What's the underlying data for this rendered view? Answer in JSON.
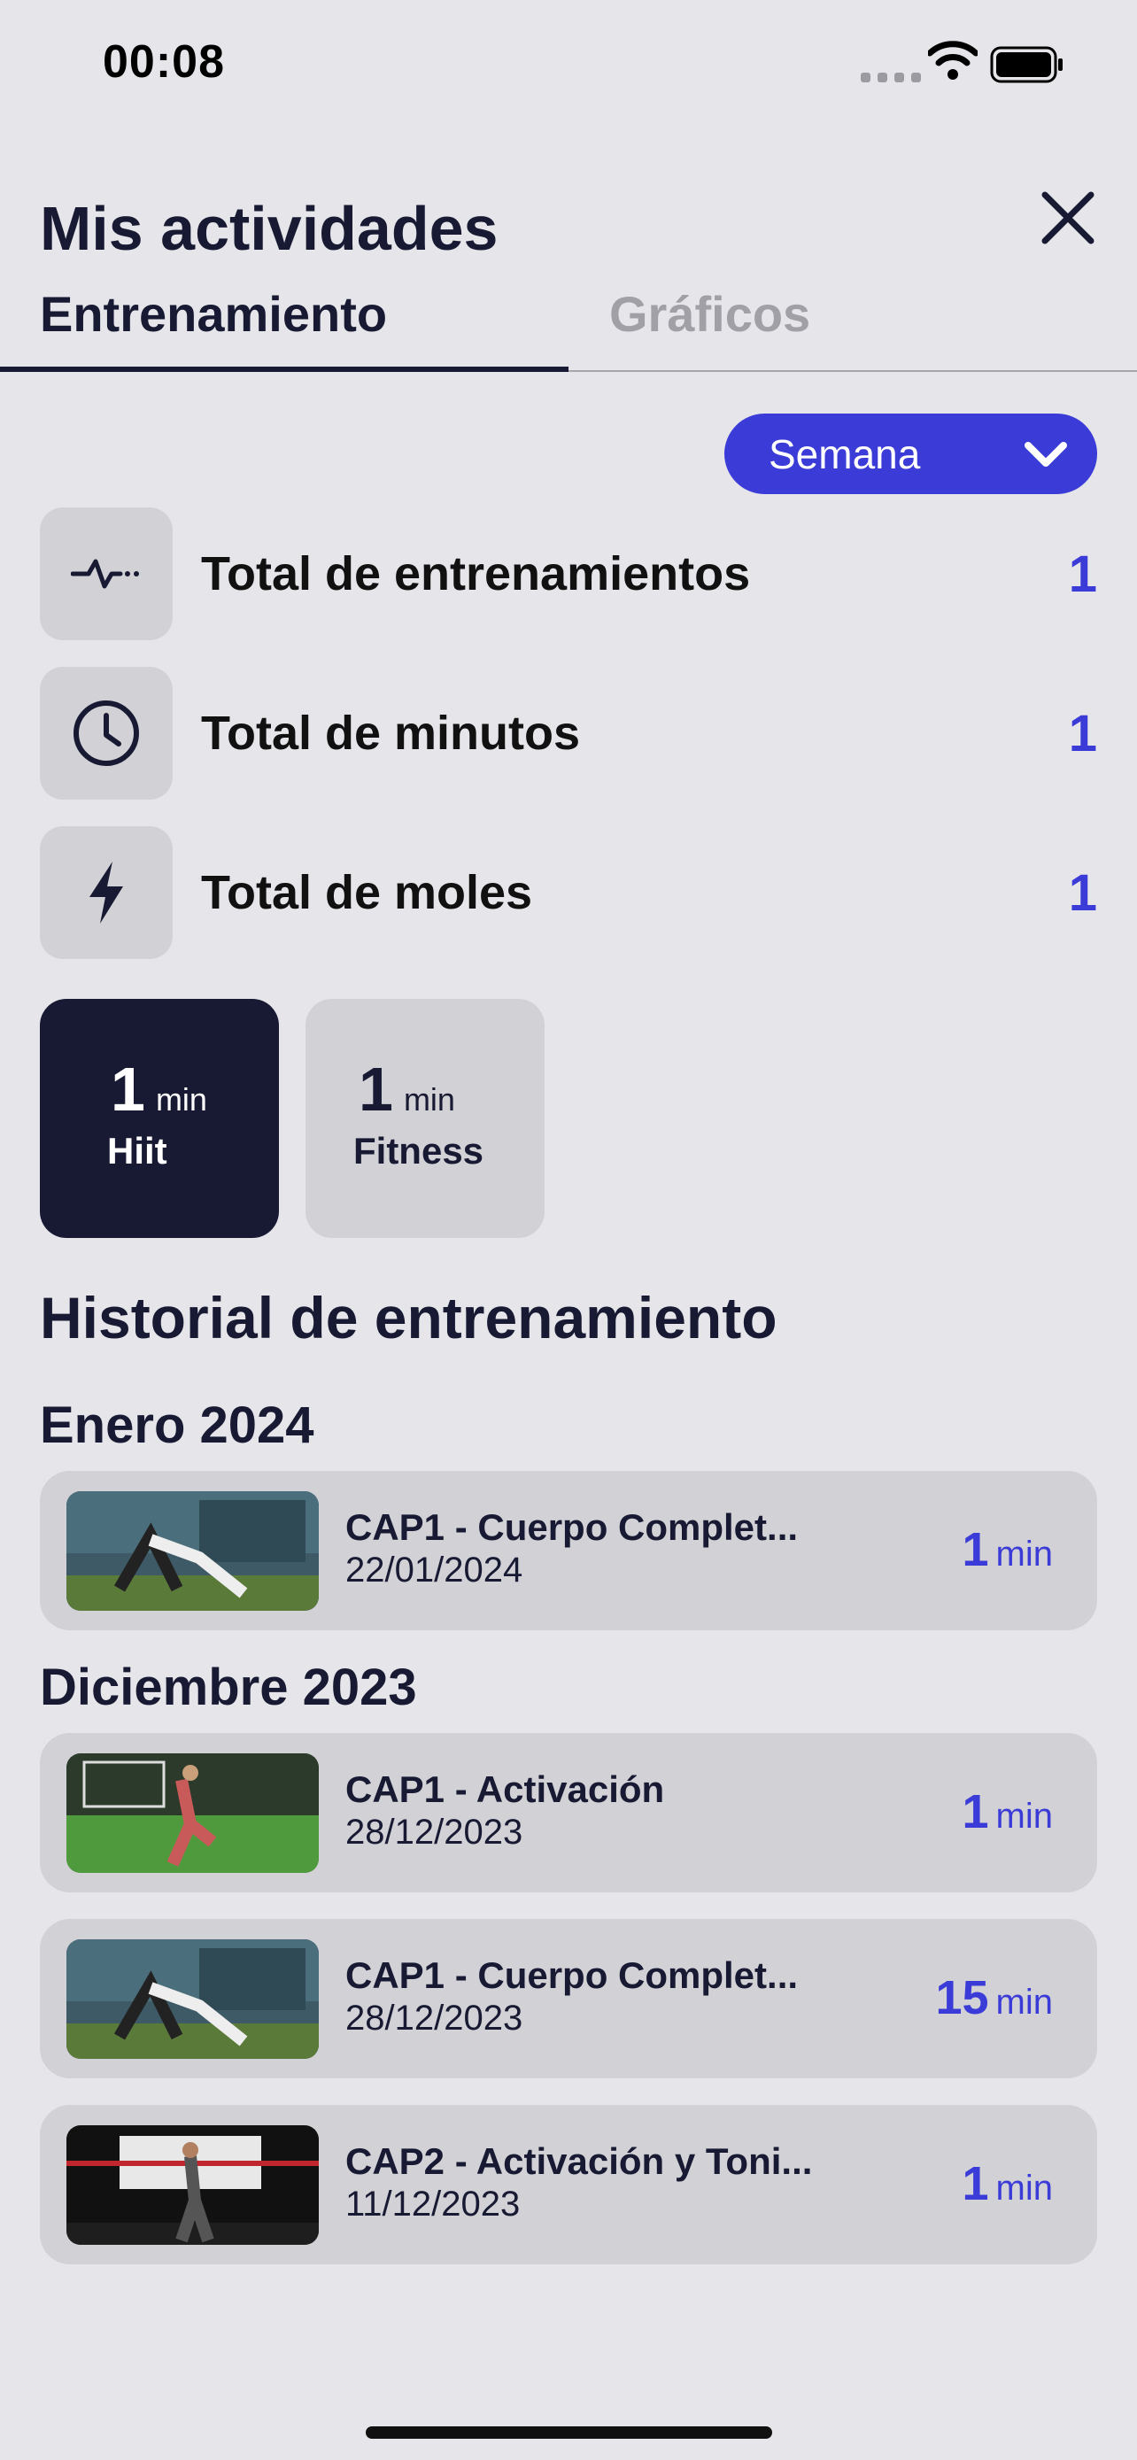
{
  "status_bar": {
    "time": "00:08"
  },
  "header": {
    "title": "Mis actividades"
  },
  "tabs": [
    {
      "label": "Entrenamiento",
      "active": true
    },
    {
      "label": "Gráficos",
      "active": false
    }
  ],
  "period_select": {
    "value": "Semana"
  },
  "stats": [
    {
      "label": "Total de entrenamientos",
      "value": "1",
      "icon": "pulse-icon"
    },
    {
      "label": "Total de minutos",
      "value": "1",
      "icon": "clock-icon"
    },
    {
      "label": "Total de moles",
      "value": "1",
      "icon": "lightning-icon"
    }
  ],
  "categories": [
    {
      "value": "1",
      "unit": "min",
      "name": "Hiit",
      "selected": true
    },
    {
      "value": "1",
      "unit": "min",
      "name": "Fitness",
      "selected": false
    }
  ],
  "history": {
    "title": "Historial de entrenamiento",
    "groups": [
      {
        "month": "Enero 2024",
        "items": [
          {
            "name": "CAP1 - Cuerpo Complet...",
            "date": "22/01/2024",
            "duration": "1",
            "unit": "min"
          }
        ]
      },
      {
        "month": "Diciembre 2023",
        "items": [
          {
            "name": "CAP1 - Activación",
            "date": "28/12/2023",
            "duration": "1",
            "unit": "min"
          },
          {
            "name": "CAP1 - Cuerpo Complet...",
            "date": "28/12/2023",
            "duration": "15",
            "unit": "min"
          },
          {
            "name": "CAP2 - Activación y Toni...",
            "date": "11/12/2023",
            "duration": "1",
            "unit": "min"
          }
        ]
      }
    ]
  },
  "colors": {
    "accent": "#3b3bd8",
    "dark": "#181a33",
    "background": "#e6e6ea",
    "card": "#d1d1d6"
  }
}
